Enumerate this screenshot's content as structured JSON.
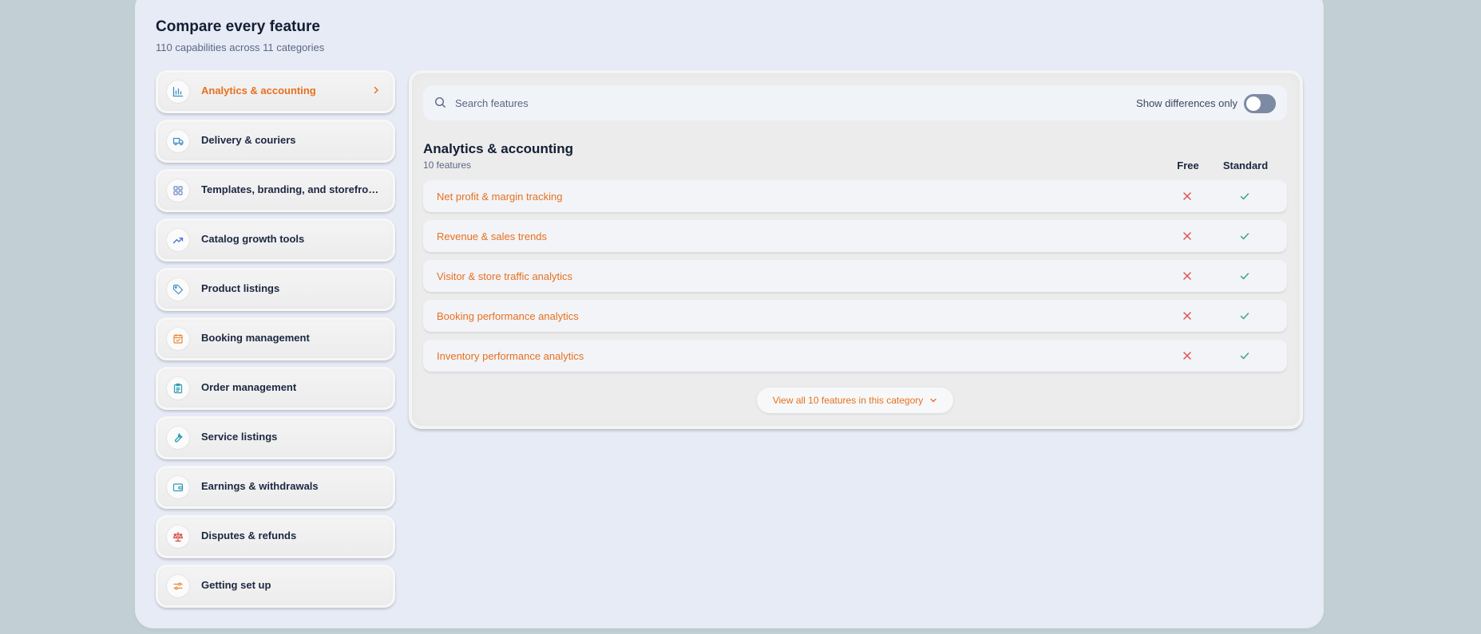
{
  "header": {
    "title": "Compare every feature",
    "subtitle": "110 capabilities across 11 categories"
  },
  "sidebar": {
    "items": [
      {
        "label": "Analytics & accounting",
        "icon": "bar-chart-icon",
        "active": true
      },
      {
        "label": "Delivery & couriers",
        "icon": "truck-icon"
      },
      {
        "label": "Templates, branding, and storefront ...",
        "icon": "grid-icon"
      },
      {
        "label": "Catalog growth tools",
        "icon": "trending-up-icon"
      },
      {
        "label": "Product listings",
        "icon": "tag-icon"
      },
      {
        "label": "Booking management",
        "icon": "calendar-check-icon"
      },
      {
        "label": "Order management",
        "icon": "clipboard-icon"
      },
      {
        "label": "Service listings",
        "icon": "wrench-icon"
      },
      {
        "label": "Earnings & withdrawals",
        "icon": "wallet-icon"
      },
      {
        "label": "Disputes & refunds",
        "icon": "scale-icon"
      },
      {
        "label": "Getting set up",
        "icon": "sliders-icon"
      }
    ]
  },
  "search": {
    "placeholder": "Search features",
    "value": "",
    "diff_toggle_label": "Show differences only",
    "diff_toggle_on": false
  },
  "category": {
    "title": "Analytics & accounting",
    "count": "10 features",
    "columns": [
      "Free",
      "Standard"
    ],
    "features": [
      {
        "name": "Net profit & margin tracking",
        "free": false,
        "standard": true
      },
      {
        "name": "Revenue & sales trends",
        "free": false,
        "standard": true
      },
      {
        "name": "Visitor & store traffic analytics",
        "free": false,
        "standard": true
      },
      {
        "name": "Booking performance analytics",
        "free": false,
        "standard": true
      },
      {
        "name": "Inventory performance analytics",
        "free": false,
        "standard": true
      }
    ],
    "view_all_label": "View all 10 features in this category"
  },
  "colors": {
    "accent": "#e8701e",
    "cross": "#e0524a",
    "check": "#3aa877"
  }
}
